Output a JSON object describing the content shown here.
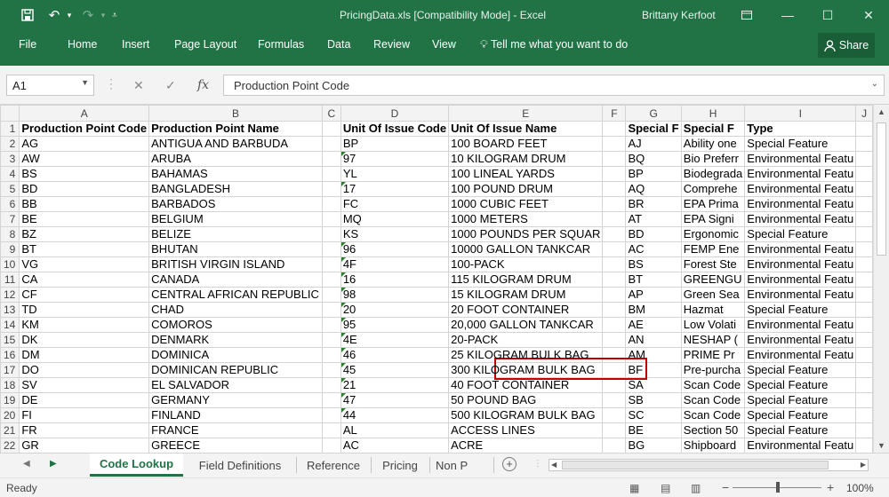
{
  "window": {
    "title": "PricingData.xls  [Compatibility Mode] - Excel",
    "user": "Brittany Kerfoot",
    "icons": [
      "save-icon",
      "undo-icon",
      "redo-icon",
      "customize-qat-icon",
      "ribbon-display-icon",
      "minimize-icon",
      "restore-icon",
      "close-icon"
    ],
    "colors": {
      "brand": "#217346",
      "highlight": "#c00000"
    }
  },
  "ribbon": {
    "tabs": [
      "File",
      "Home",
      "Insert",
      "Page Layout",
      "Formulas",
      "Data",
      "Review",
      "View"
    ],
    "tell_me": "Tell me what you want to do",
    "share": "Share"
  },
  "formula_bar": {
    "name_box": "A1",
    "fx": "fx",
    "content": "Production Point Code"
  },
  "sheet": {
    "columns": [
      "A",
      "B",
      "C",
      "D",
      "E",
      "F",
      "G",
      "H",
      "I",
      "J"
    ],
    "row_numbers": [
      1,
      2,
      3,
      4,
      5,
      6,
      7,
      8,
      9,
      10,
      11,
      12,
      13,
      14,
      15,
      16,
      17,
      18,
      19,
      20,
      21,
      22
    ],
    "rows": [
      [
        "Production Point Code",
        "Production Point Name",
        "",
        "Unit Of Issue Code",
        "Unit Of Issue Name",
        "",
        "Special F",
        "Special F",
        "Type",
        ""
      ],
      [
        "AG",
        "ANTIGUA AND BARBUDA",
        "",
        "BP",
        "100 BOARD FEET",
        "",
        "AJ",
        "Ability one",
        "Special Feature",
        ""
      ],
      [
        "AW",
        "ARUBA",
        "",
        "97",
        "10 KILOGRAM DRUM",
        "",
        "BQ",
        "Bio Preferr",
        "Environmental Featu",
        ""
      ],
      [
        "BS",
        "BAHAMAS",
        "",
        "YL",
        "100 LINEAL YARDS",
        "",
        "BP",
        "Biodegrada",
        "Environmental Featu",
        ""
      ],
      [
        "BD",
        "BANGLADESH",
        "",
        "17",
        "100 POUND DRUM",
        "",
        "AQ",
        "Comprehe",
        "Environmental Featu",
        ""
      ],
      [
        "BB",
        "BARBADOS",
        "",
        "FC",
        "1000 CUBIC FEET",
        "",
        "BR",
        "EPA Prima",
        "Environmental Featu",
        ""
      ],
      [
        "BE",
        "BELGIUM",
        "",
        "MQ",
        "1000 METERS",
        "",
        "AT",
        "EPA Signi",
        "Environmental Featu",
        ""
      ],
      [
        "BZ",
        "BELIZE",
        "",
        "KS",
        "1000 POUNDS PER SQUAR",
        "",
        "BD",
        "Ergonomic",
        "Special Feature",
        ""
      ],
      [
        "BT",
        "BHUTAN",
        "",
        "96",
        "10000 GALLON TANKCAR",
        "",
        "AC",
        "FEMP Ene",
        "Environmental Featu",
        ""
      ],
      [
        "VG",
        "BRITISH VIRGIN ISLAND",
        "",
        "4F",
        "100-PACK",
        "",
        "BS",
        "Forest Ste",
        "Environmental Featu",
        ""
      ],
      [
        "CA",
        "CANADA",
        "",
        "16",
        "115 KILOGRAM DRUM",
        "",
        "BT",
        "GREENGU",
        "Environmental Featu",
        ""
      ],
      [
        "CF",
        "CENTRAL AFRICAN REPUBLIC",
        "",
        "98",
        "15 KILOGRAM DRUM",
        "",
        "AP",
        "Green Sea",
        "Environmental Featu",
        ""
      ],
      [
        "TD",
        "CHAD",
        "",
        "20",
        "20 FOOT CONTAINER",
        "",
        "BM",
        "Hazmat",
        "Special Feature",
        ""
      ],
      [
        "KM",
        "COMOROS",
        "",
        "95",
        "20,000 GALLON TANKCAR",
        "",
        "AE",
        "Low Volati",
        "Environmental Featu",
        ""
      ],
      [
        "DK",
        "DENMARK",
        "",
        "4E",
        "20-PACK",
        "",
        "AN",
        "NESHAP (",
        "Environmental Featu",
        ""
      ],
      [
        "DM",
        "DOMINICA",
        "",
        "46",
        "25 KILOGRAM BULK BAG",
        "",
        "AM",
        "PRIME Pr",
        "Environmental Featu",
        ""
      ],
      [
        "DO",
        "DOMINICAN REPUBLIC",
        "",
        "45",
        "300 KILOGRAM BULK BAG",
        "",
        "BF",
        "Pre-purcha",
        "Special Feature",
        ""
      ],
      [
        "SV",
        "EL SALVADOR",
        "",
        "21",
        "40 FOOT CONTAINER",
        "",
        "SA",
        "Scan Code",
        "Special Feature",
        ""
      ],
      [
        "DE",
        "GERMANY",
        "",
        "47",
        "50 POUND BAG",
        "",
        "SB",
        "Scan Code",
        "Special Feature",
        ""
      ],
      [
        "FI",
        "FINLAND",
        "",
        "44",
        "500 KILOGRAM BULK BAG",
        "",
        "SC",
        "Scan Code",
        "Special Feature",
        ""
      ],
      [
        "FR",
        "FRANCE",
        "",
        "AL",
        "ACCESS LINES",
        "",
        "BE",
        "Section 50",
        "Special Feature",
        ""
      ],
      [
        "GR",
        "GREECE",
        "",
        "AC",
        "ACRE",
        "",
        "BG",
        "Shipboard",
        "Environmental Featu",
        ""
      ]
    ]
  },
  "sheet_tabs": [
    "Code Lookup",
    "Field Definitions",
    "Reference",
    "Pricing",
    "Non P"
  ],
  "active_tab": "Code Lookup",
  "status": {
    "ready": "Ready",
    "zoom": "100%"
  }
}
